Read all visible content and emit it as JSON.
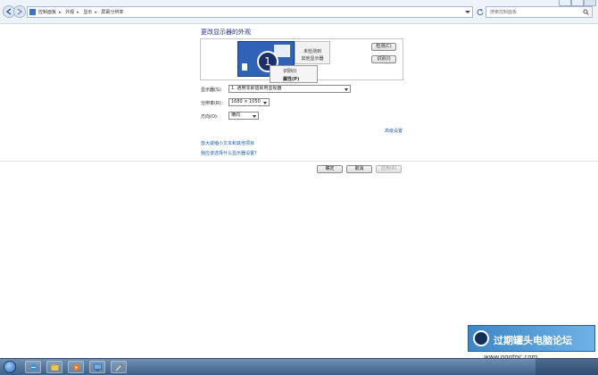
{
  "address_bar": {
    "breadcrumbs": [
      "控制面板",
      "外观",
      "显示",
      "屏幕分辨率"
    ],
    "search_placeholder": "搜索控制面板"
  },
  "main": {
    "title": "更改显示器的外观",
    "monitor_primary_number": "1",
    "monitor_secondary_line1": "未检测到",
    "monitor_secondary_line2": "其他显示器",
    "context_menu": [
      "识别(I)",
      "属性(P)"
    ],
    "detect_button": "检测(C)",
    "identify_button": "识别(I)",
    "display_label": "显示器(S):",
    "display_value": "1. 通用非即插即用监视器",
    "resolution_label": "分辨率(R):",
    "resolution_value": "1680 × 1050",
    "orientation_label": "方向(O):",
    "orientation_value": "横向",
    "advanced_link": "高级设置",
    "link_text_size": "放大或缩小文本和其他项目",
    "link_choose_settings": "我应该选择什么显示器设置?",
    "ok_button": "确定",
    "cancel_button": "取消",
    "apply_button": "应用(A)"
  },
  "watermark": {
    "text": "过期罐头电脑论坛",
    "url": "www.gqgtpc.com"
  },
  "colors": {
    "title": "#1e3287",
    "link": "#1a5fb4",
    "monitor": "#2f63b8"
  }
}
